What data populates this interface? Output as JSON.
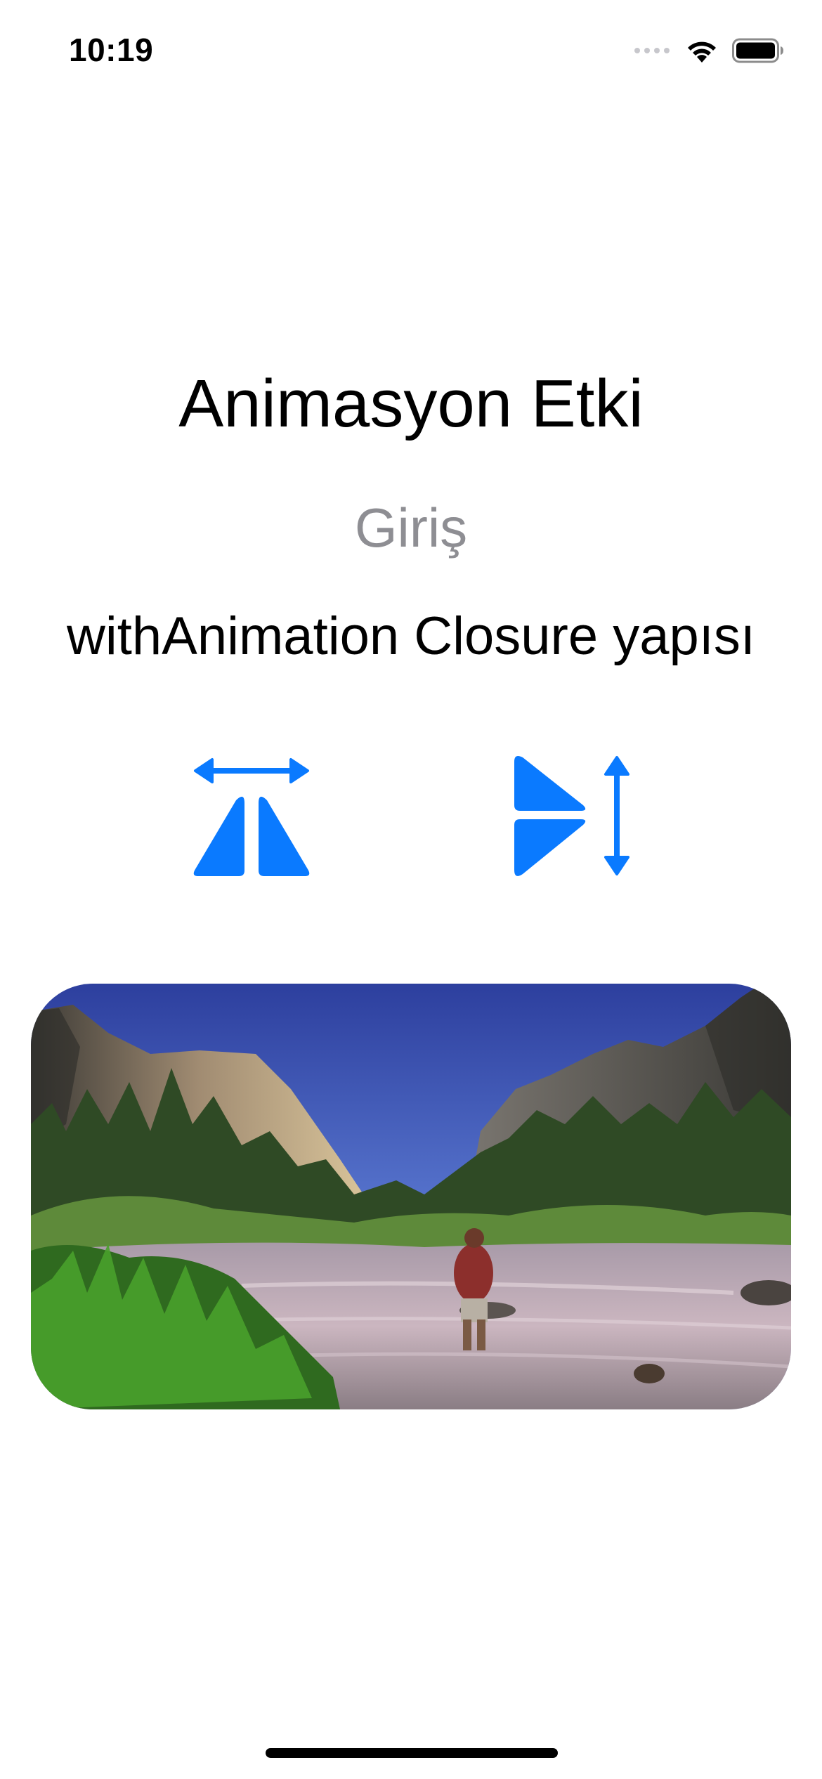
{
  "status_bar": {
    "time": "10:19"
  },
  "content": {
    "title": "Animasyon Etki",
    "subtitle": "Giriş",
    "headline": "withAnimation Closure yapısı"
  },
  "buttons": {
    "left_icon": "arrow-left-right-triangle-icon",
    "right_icon": "play-arrow-up-down-icon"
  },
  "image": {
    "description_icon": "landscape-photo"
  },
  "colors": {
    "accent": "#0A7AFF",
    "secondary_text": "#8E8E93"
  }
}
